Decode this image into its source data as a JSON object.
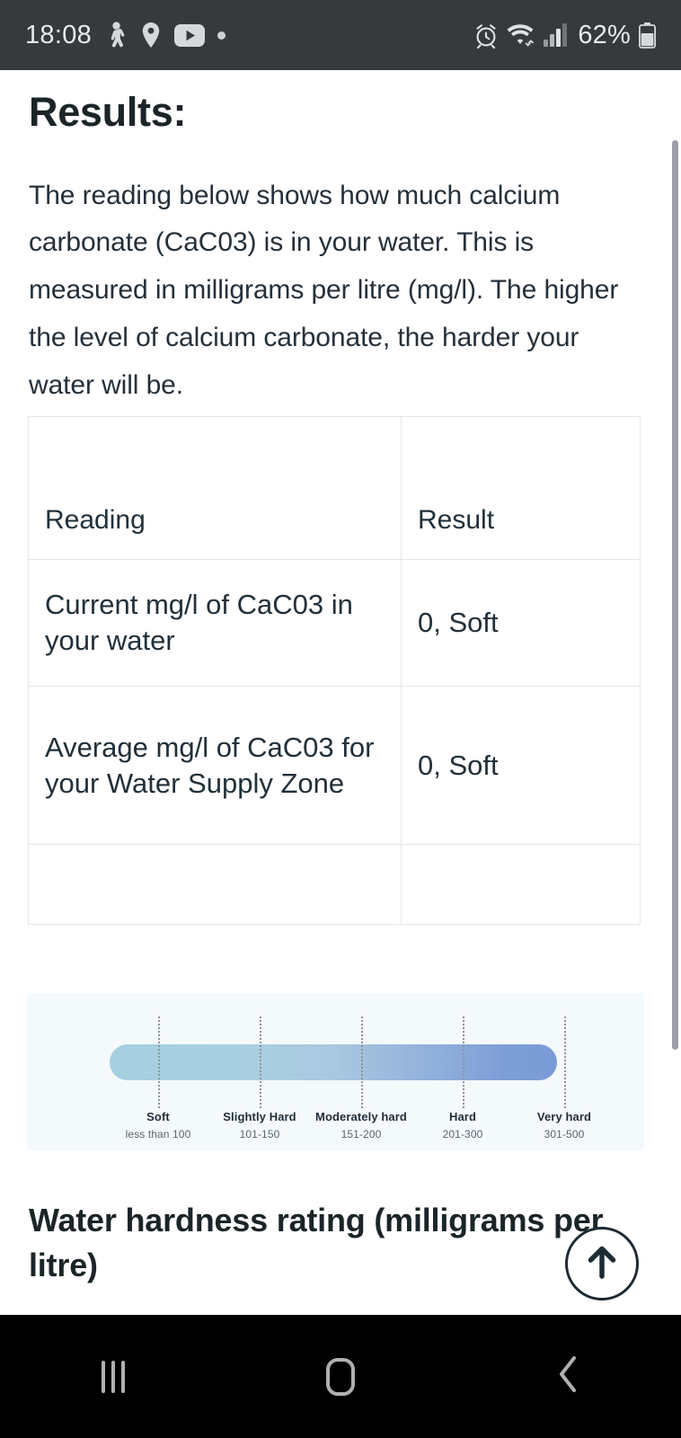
{
  "status_bar": {
    "time": "18:08",
    "battery_percent": "62%",
    "left_icons": [
      "activity-icon",
      "location-pin-icon",
      "youtube-icon",
      "dot-icon"
    ],
    "right_icons": [
      "alarm-icon",
      "wifi-icon",
      "signal-bars-icon",
      "battery-icon"
    ],
    "background_color": "#363a3d"
  },
  "page": {
    "title": "Results:",
    "intro": "The reading below shows how much calcium carbonate (CaC03) is in your water. This is measured in milligrams per litre (mg/l). The higher the level of calcium carbonate, the harder your water will be.",
    "sub_heading": "Water hardness rating (milligrams per litre)"
  },
  "results_table": {
    "headers": [
      "Reading",
      "Result"
    ],
    "rows": [
      {
        "reading": "Current mg/l of CaC03 in your water",
        "result": "0, Soft"
      },
      {
        "reading": "Average mg/l of CaC03 for your Water Supply Zone",
        "result": "0, Soft"
      },
      {
        "reading": "",
        "result": ""
      }
    ]
  },
  "chart_data": {
    "type": "bar",
    "title": "Water hardness rating (milligrams per litre)",
    "xlabel": "",
    "ylabel": "",
    "categories": [
      "Soft",
      "Slightly Hard",
      "Moderately hard",
      "Hard",
      "Very hard"
    ],
    "tick_ranges": [
      "less than 100",
      "101-150",
      "151-200",
      "201-300",
      "301-500"
    ],
    "tick_positions_pct": [
      11,
      31,
      51,
      71,
      91
    ],
    "xlim": [
      0,
      500
    ],
    "grid": false,
    "legend": "none",
    "gradient_start_color": "#a6cfe0",
    "gradient_end_color": "#7a9bd6",
    "panel_background": "#f4f9fc"
  },
  "scroll_top_button": {
    "icon": "arrow-up-icon",
    "border_color": "#1c2b33"
  },
  "nav_bar": {
    "items": [
      "recents-button",
      "home-button",
      "back-button"
    ],
    "background_color": "#000000",
    "icon_color": "#b0b0b0"
  }
}
